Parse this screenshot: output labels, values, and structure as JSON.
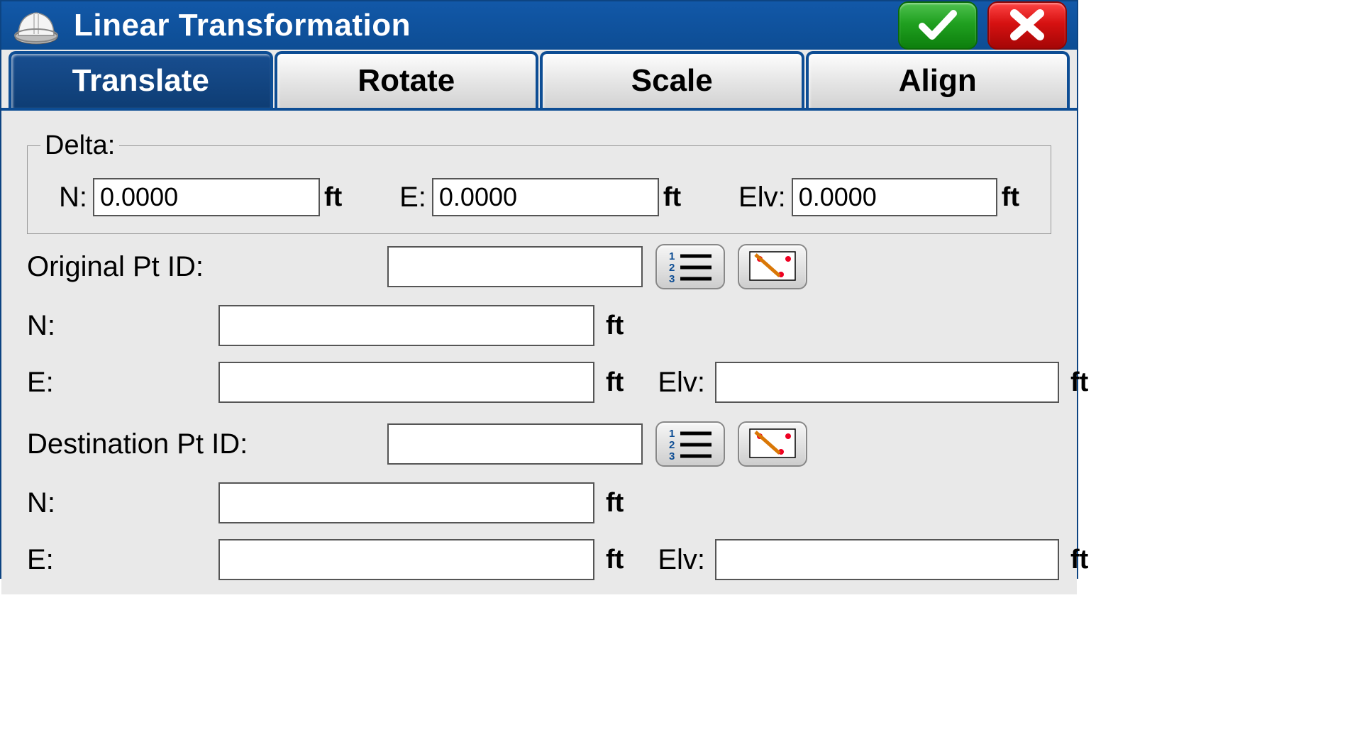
{
  "title": "Linear Transformation",
  "tabs": [
    "Translate",
    "Rotate",
    "Scale",
    "Align"
  ],
  "active_tab": 0,
  "delta": {
    "legend": "Delta:",
    "n_label": "N:",
    "n_value": "0.0000",
    "e_label": "E:",
    "e_value": "0.0000",
    "elv_label": "Elv:",
    "elv_value": "0.0000",
    "unit": "ft"
  },
  "original": {
    "label": "Original Pt ID:",
    "id_value": "",
    "n_label": "N:",
    "n_value": "",
    "e_label": "E:",
    "e_value": "",
    "elv_label": "Elv:",
    "elv_value": ""
  },
  "destination": {
    "label": "Destination Pt ID:",
    "id_value": "",
    "n_label": "N:",
    "n_value": "",
    "e_label": "E:",
    "e_value": "",
    "elv_label": "Elv:",
    "elv_value": ""
  },
  "unit": "ft"
}
